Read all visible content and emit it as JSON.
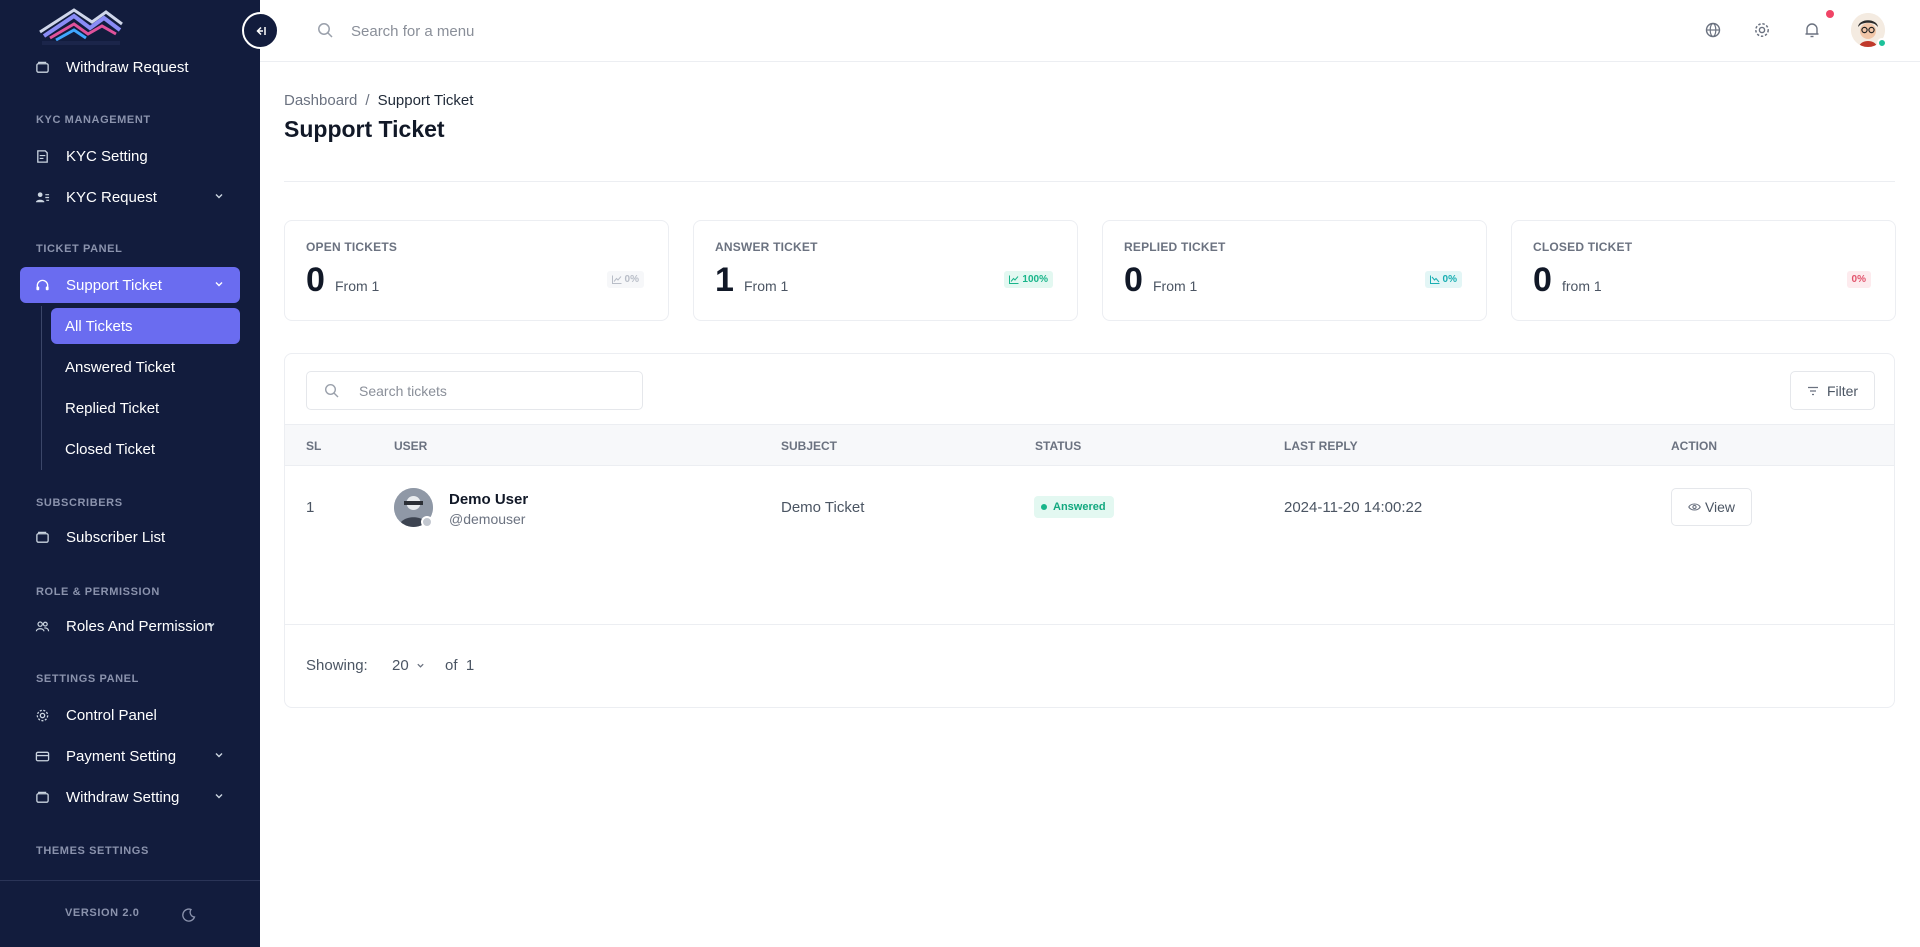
{
  "sidebar": {
    "logo_name": "house-logo",
    "items": [
      {
        "label": "Withdraw Request",
        "icon": "wallet-icon"
      },
      {
        "section": "KYC MANAGEMENT"
      },
      {
        "label": "KYC Setting",
        "icon": "document-icon"
      },
      {
        "label": "KYC Request",
        "icon": "user-list-icon",
        "has_children": true
      },
      {
        "section": "TICKET PANEL"
      },
      {
        "label": "Support Ticket",
        "icon": "headset-icon",
        "active": true,
        "has_children": true
      },
      {
        "section": "SUBSCRIBERS"
      },
      {
        "label": "Subscriber List",
        "icon": "wallet-icon"
      },
      {
        "section": "ROLE & PERMISSION"
      },
      {
        "label": "Roles And Permission",
        "icon": "users-icon",
        "has_children": true
      },
      {
        "section": "SETTINGS PANEL"
      },
      {
        "label": "Control Panel",
        "icon": "gear-icon"
      },
      {
        "label": "Payment Setting",
        "icon": "card-icon",
        "has_children": true
      },
      {
        "label": "Withdraw Setting",
        "icon": "wallet-icon",
        "has_children": true
      },
      {
        "section": "THEMES SETTINGS"
      }
    ],
    "ticket_submenu": [
      {
        "label": "All Tickets",
        "active": true
      },
      {
        "label": "Answered Ticket"
      },
      {
        "label": "Replied Ticket"
      },
      {
        "label": "Closed Ticket"
      }
    ],
    "version": "VERSION 2.0",
    "colors": {
      "background": "#121c3d",
      "active": "#6a6cf0"
    }
  },
  "topbar": {
    "search_placeholder": "Search for a menu",
    "icons": [
      "globe-icon",
      "settings-icon",
      "bell-icon"
    ],
    "has_notification": true
  },
  "breadcrumb": {
    "home": "Dashboard",
    "separator": "/",
    "current": "Support Ticket"
  },
  "page_title": "Support Ticket",
  "stats": [
    {
      "label": "OPEN TICKETS",
      "value": "0",
      "from": "From 1",
      "percent": "0%",
      "tone": "neutral"
    },
    {
      "label": "ANSWER TICKET",
      "value": "1",
      "from": "From 1",
      "percent": "100%",
      "tone": "green"
    },
    {
      "label": "REPLIED TICKET",
      "value": "0",
      "from": "From 1",
      "percent": "0%",
      "tone": "teal"
    },
    {
      "label": "CLOSED TICKET",
      "value": "0",
      "from": "from 1",
      "percent": "0%",
      "tone": "red"
    }
  ],
  "table": {
    "search_placeholder": "Search tickets",
    "filter_label": "Filter",
    "columns": [
      "SL",
      "USER",
      "SUBJECT",
      "STATUS",
      "LAST REPLY",
      "ACTION"
    ],
    "rows": [
      {
        "sl": "1",
        "name": "Demo User",
        "handle": "@demouser",
        "subject": "Demo Ticket",
        "status": "Answered",
        "last_reply": "2024-11-20 14:00:22",
        "action": "View"
      }
    ],
    "footer": {
      "showing_label": "Showing:",
      "per_page": "20",
      "of_label": "of",
      "total": "1"
    }
  }
}
